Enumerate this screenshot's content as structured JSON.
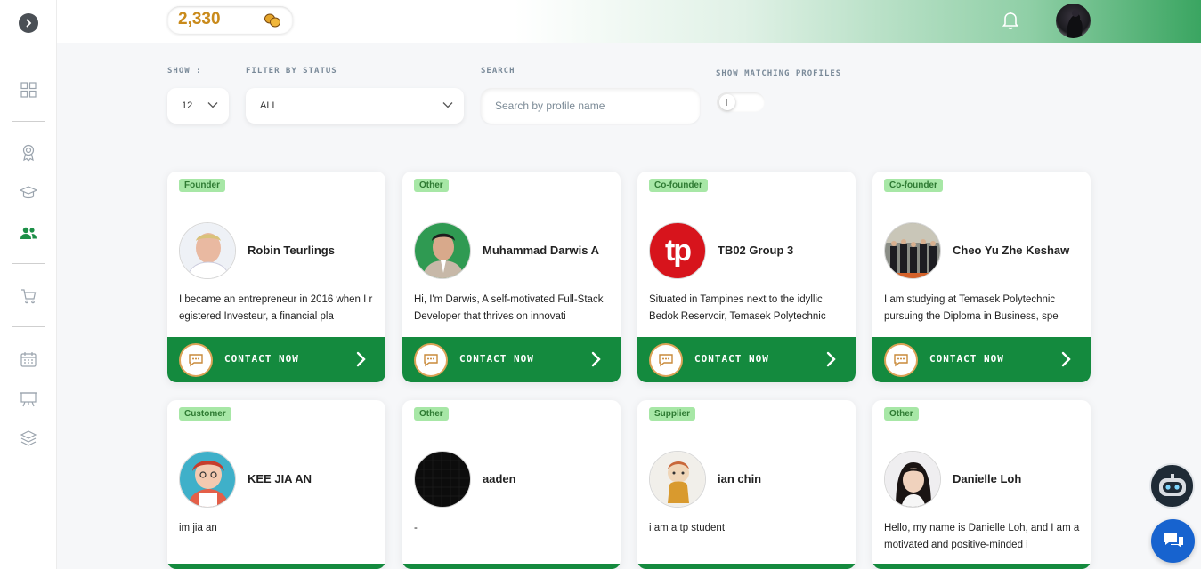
{
  "header": {
    "coins": "2,330",
    "coin_icon": "coins-icon",
    "notification_icon": "bell-icon",
    "avatar_icon": "user-avatar"
  },
  "sidebar": {
    "items": [
      {
        "icon": "chevron-right-icon"
      },
      {
        "icon": "dashboard-grid-icon"
      },
      {
        "icon": "award-ribbon-icon"
      },
      {
        "icon": "graduation-cap-icon"
      },
      {
        "icon": "users-icon",
        "active": true
      },
      {
        "icon": "cart-icon"
      },
      {
        "icon": "calendar-icon"
      },
      {
        "icon": "presentation-board-icon"
      },
      {
        "icon": "layers-icon"
      }
    ]
  },
  "filters": {
    "show_label": "SHOW :",
    "show_value": "12",
    "status_label": "FILTER BY STATUS",
    "status_value": "ALL",
    "search_label": "SEARCH",
    "search_placeholder": "Search by profile name",
    "matching_label": "SHOW MATCHING PROFILES"
  },
  "contact_label": "CONTACT NOW",
  "profiles": [
    {
      "tag": "Founder",
      "name": "Robin Teurlings",
      "desc": "I became an entrepreneur in 2016 when I registered Investeur, a financial pla"
    },
    {
      "tag": "Other",
      "name": "Muhammad Darwis A",
      "desc": "Hi, I'm Darwis, A self-motivated Full-Stack Developer that thrives on innovati"
    },
    {
      "tag": "Co-founder",
      "name": "TB02 Group 3",
      "desc": "Situated in Tampines next to the idyllic Bedok Reservoir, Temasek Polytechnic",
      "logo_text": "tp"
    },
    {
      "tag": "Co-founder",
      "name": "Cheo Yu Zhe Keshaw",
      "desc": "I am studying at Temasek Polytechnic pursuing the Diploma in Business, spe"
    },
    {
      "tag": "Customer",
      "name": "KEE JIA AN",
      "desc": "im jia an"
    },
    {
      "tag": "Other",
      "name": "aaden",
      "desc": "-"
    },
    {
      "tag": "Supplier",
      "name": "ian chin",
      "desc": "i am a tp student"
    },
    {
      "tag": "Other",
      "name": "Danielle Loh",
      "desc": "Hello, my name is Danielle Loh, and I am a motivated and positive-minded i"
    }
  ],
  "colors": {
    "accent_green": "#148a3e",
    "tag_bg": "#a7e7a6",
    "coin_gold": "#c98a1b",
    "chat_blue": "#1763cf"
  }
}
